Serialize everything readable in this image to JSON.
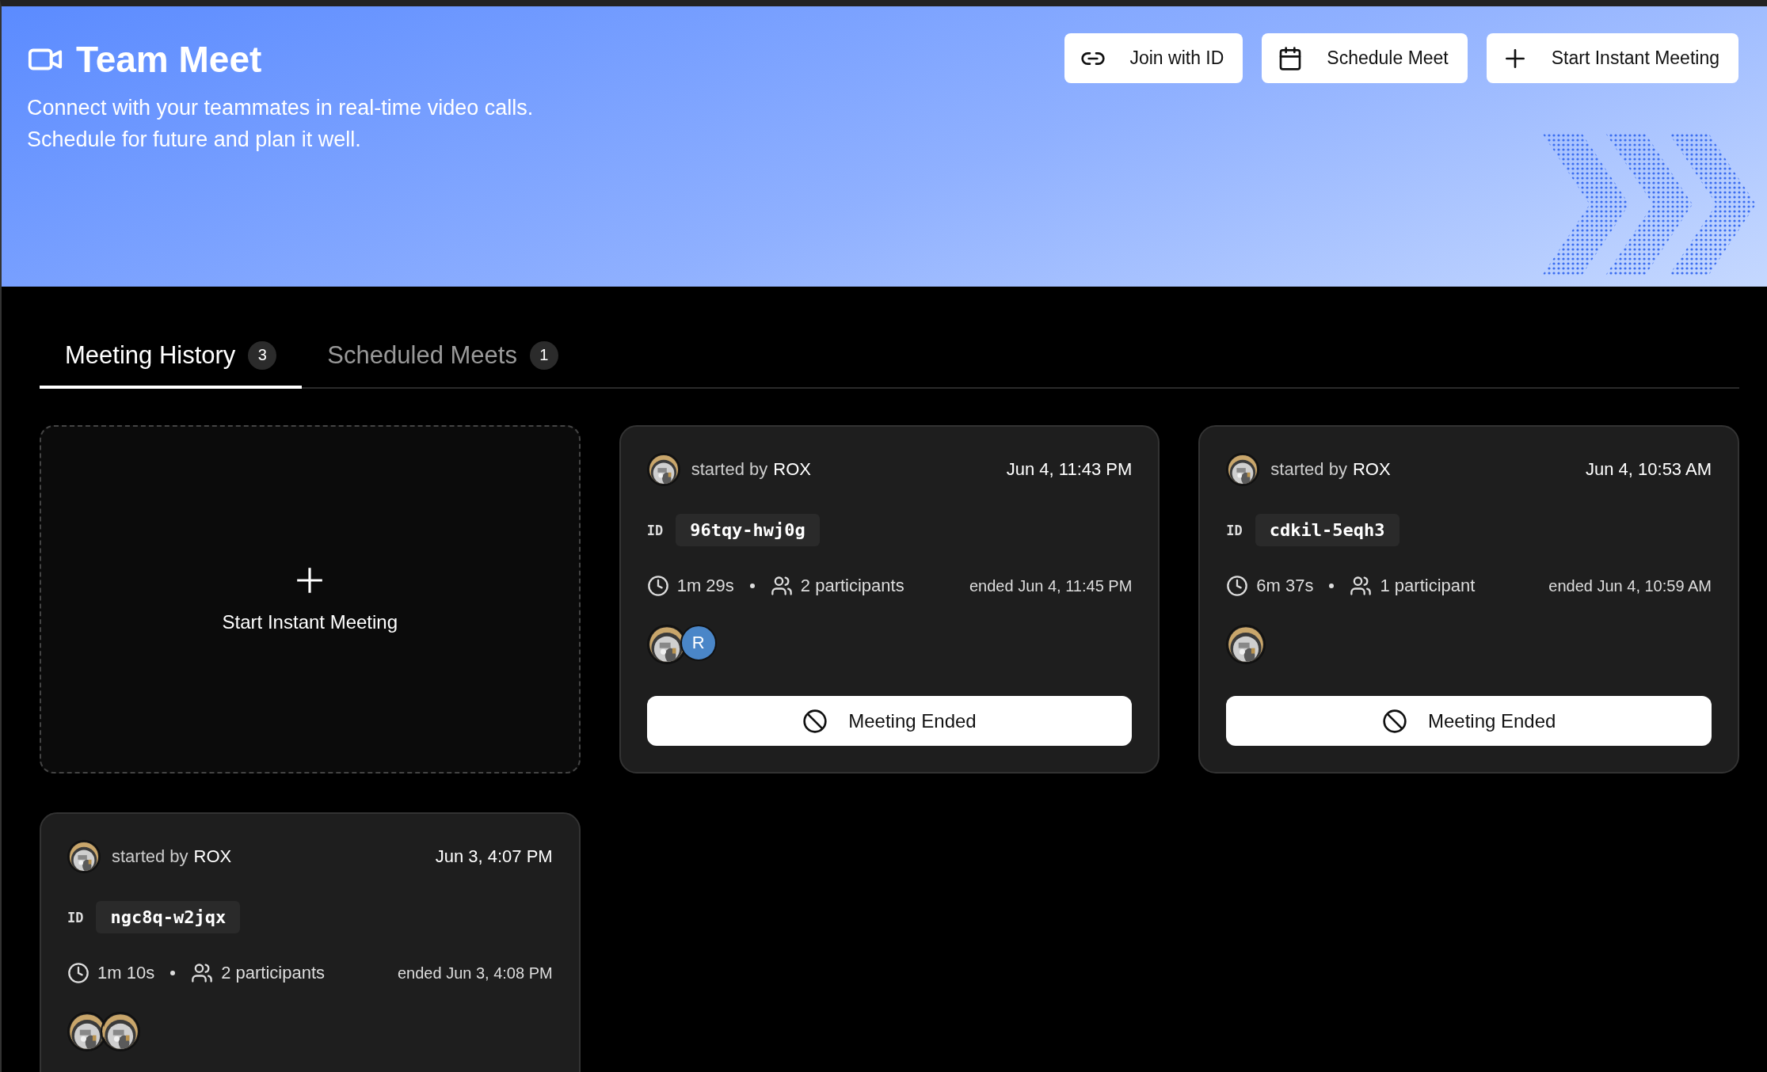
{
  "header": {
    "title": "Team Meet",
    "subtitle_lines": [
      "Connect with your teammates in real-time video calls.",
      "Schedule for future and plan it well."
    ],
    "actions": [
      {
        "label": "Join with ID",
        "kind": "link"
      },
      {
        "label": "Schedule Meet",
        "kind": "calendar"
      },
      {
        "label": "Start Instant Meeting",
        "kind": "plus"
      }
    ]
  },
  "tabs": [
    {
      "label": "Meeting History",
      "count": "3",
      "selected": true
    },
    {
      "label": "Scheduled Meets",
      "count": "1",
      "selected": false
    }
  ],
  "new_meeting_card": {
    "label": "Start Instant Meeting"
  },
  "meetings": [
    {
      "started_by": "started by",
      "host": "ROX",
      "started": "Jun 4, 11:43 PM",
      "id_label": "ID",
      "meeting_id": "96tqy-hwj0g",
      "duration": "1m 29s",
      "participants": "2 participants",
      "ended": "ended Jun 4, 11:45 PM",
      "avatars": [
        {
          "kind": "picture"
        },
        {
          "kind": "initial",
          "initial": "R",
          "color": "#4a86c8"
        }
      ],
      "status": "Meeting Ended"
    },
    {
      "started_by": "started by",
      "host": "ROX",
      "started": "Jun 4, 10:53 AM",
      "id_label": "ID",
      "meeting_id": "cdkil-5eqh3",
      "duration": "6m 37s",
      "participants": "1 participant",
      "ended": "ended Jun 4, 10:59 AM",
      "avatars": [
        {
          "kind": "picture"
        }
      ],
      "status": "Meeting Ended"
    },
    {
      "started_by": "started by",
      "host": "ROX",
      "started": "Jun 3, 4:07 PM",
      "id_label": "ID",
      "meeting_id": "ngc8q-w2jqx",
      "duration": "1m 10s",
      "participants": "2 participants",
      "ended": "ended Jun 3, 4:08 PM",
      "avatars": [
        {
          "kind": "picture"
        },
        {
          "kind": "picture"
        }
      ]
    }
  ]
}
